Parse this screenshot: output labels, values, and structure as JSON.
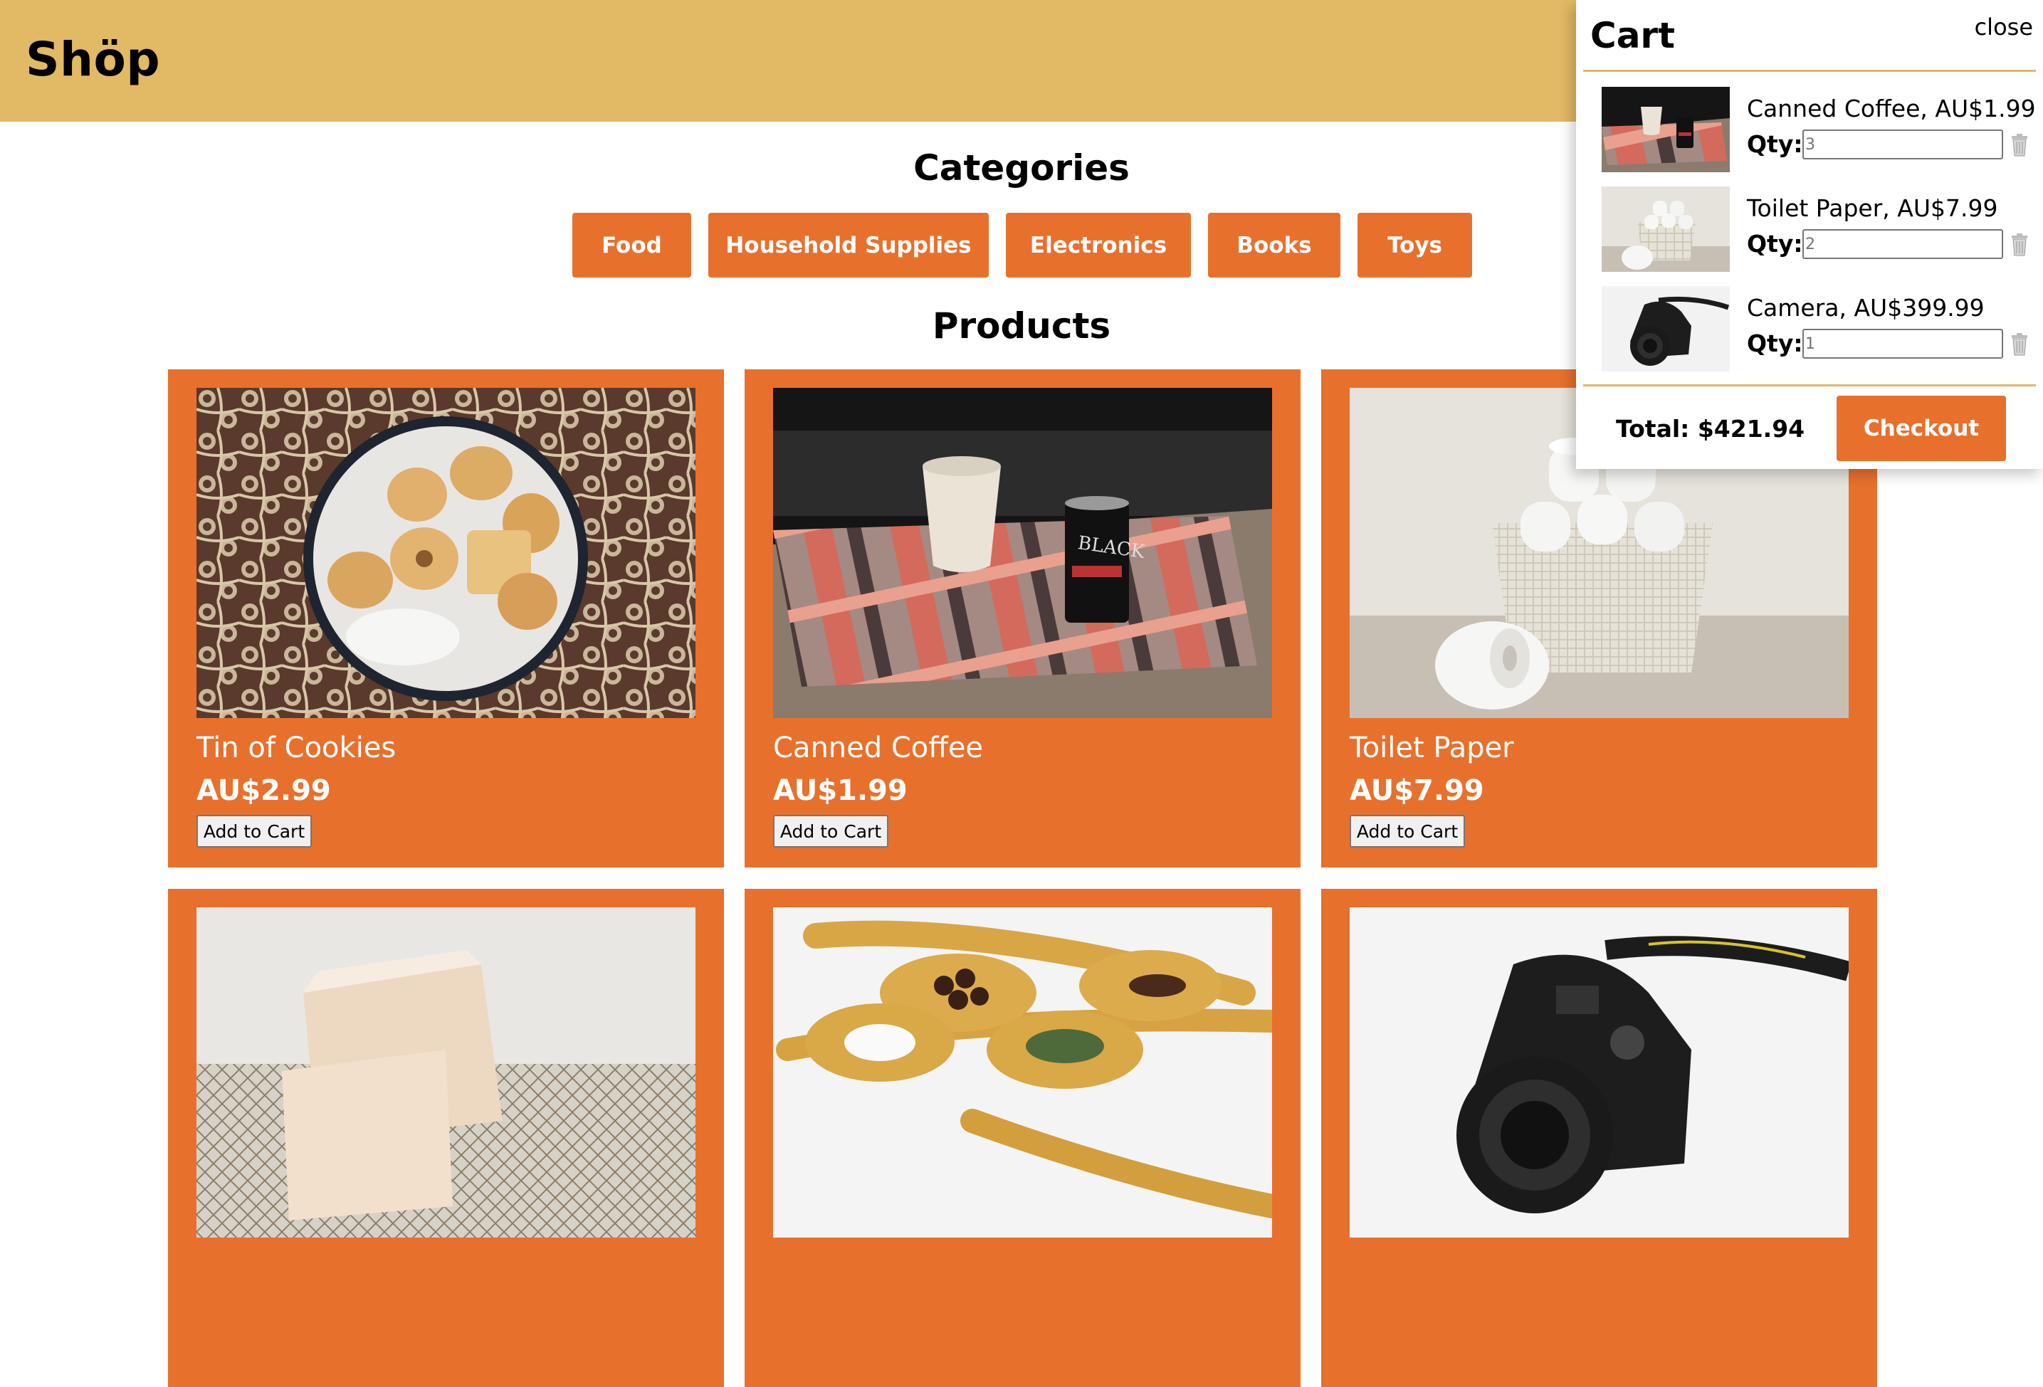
{
  "header": {
    "brand": "Shöp"
  },
  "categories": {
    "title": "Categories",
    "items": [
      {
        "label": "Food"
      },
      {
        "label": "Household Supplies"
      },
      {
        "label": "Electronics"
      },
      {
        "label": "Books"
      },
      {
        "label": "Toys"
      }
    ]
  },
  "products": {
    "title": "Products",
    "add_label": "Add to Cart",
    "items": [
      {
        "name": "Tin of Cookies",
        "price": "AU$2.99",
        "image": "cookies-tin-photo"
      },
      {
        "name": "Canned Coffee",
        "price": "AU$1.99",
        "image": "canned-coffee-photo"
      },
      {
        "name": "Toilet Paper",
        "price": "AU$7.99",
        "image": "toilet-paper-photo"
      },
      {
        "name": "",
        "price": "",
        "image": "soap-bars-photo"
      },
      {
        "name": "",
        "price": "",
        "image": "spices-spoons-photo"
      },
      {
        "name": "",
        "price": "",
        "image": "camera-photo"
      }
    ]
  },
  "cart": {
    "title": "Cart",
    "close_label": "close",
    "qty_label": "Qty:",
    "items": [
      {
        "name": "Canned Coffee, AU$1.99",
        "qty": "3",
        "image": "canned-coffee-thumb"
      },
      {
        "name": "Toilet Paper, AU$7.99",
        "qty": "2",
        "image": "toilet-paper-thumb"
      },
      {
        "name": "Camera, AU$399.99",
        "qty": "1",
        "image": "camera-thumb"
      }
    ],
    "total": "Total: $421.94",
    "checkout_label": "Checkout"
  },
  "colors": {
    "header": "#E2B964",
    "accent": "#E8702D",
    "card_text": "#FFFFFF"
  }
}
